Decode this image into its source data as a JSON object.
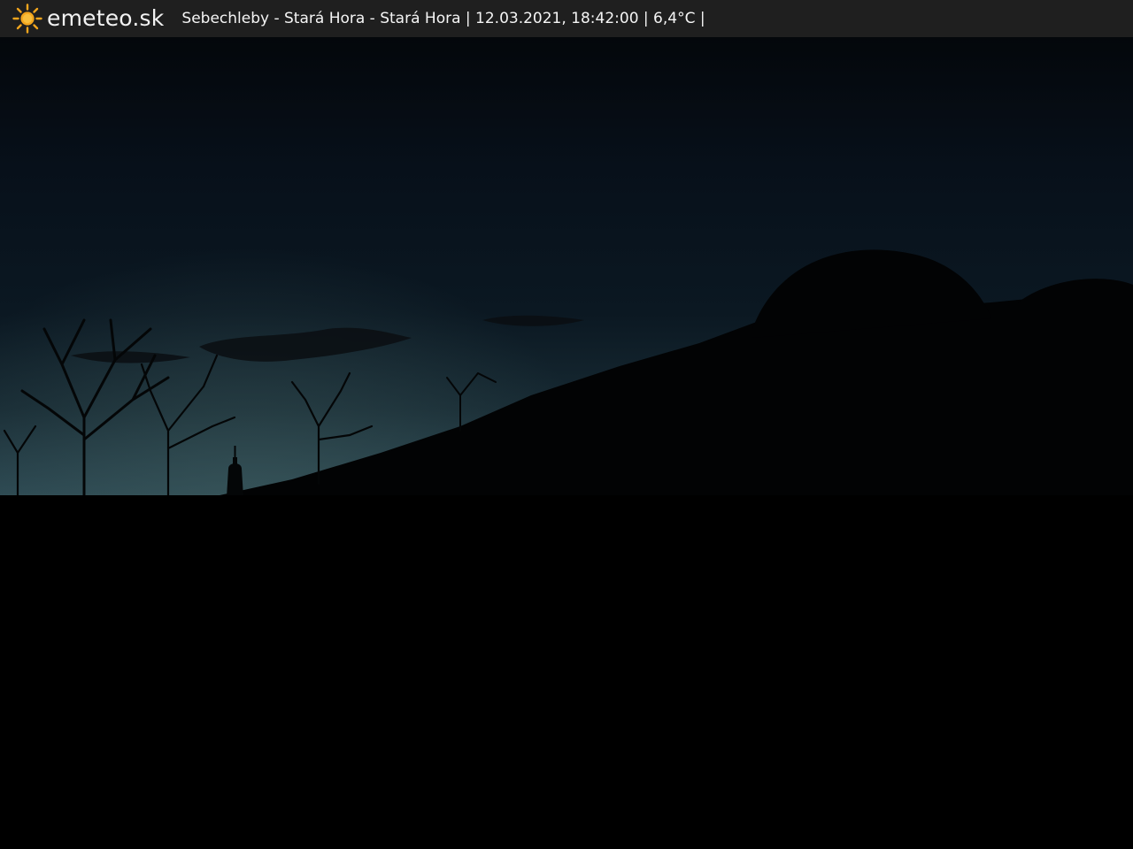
{
  "header": {
    "logo_icon": "sun-icon",
    "brand": "emeteo.sk",
    "caption": "Sebechleby - Stará Hora - Stará Hora | 12.03.2021, 18:42:00 | 6,4°C |"
  },
  "colors": {
    "bar_background": "#1f1f1f",
    "sun": "#f2a51d",
    "sky_top": "#05080d",
    "sky_horizon": "#27414a",
    "ground": "#000000"
  }
}
